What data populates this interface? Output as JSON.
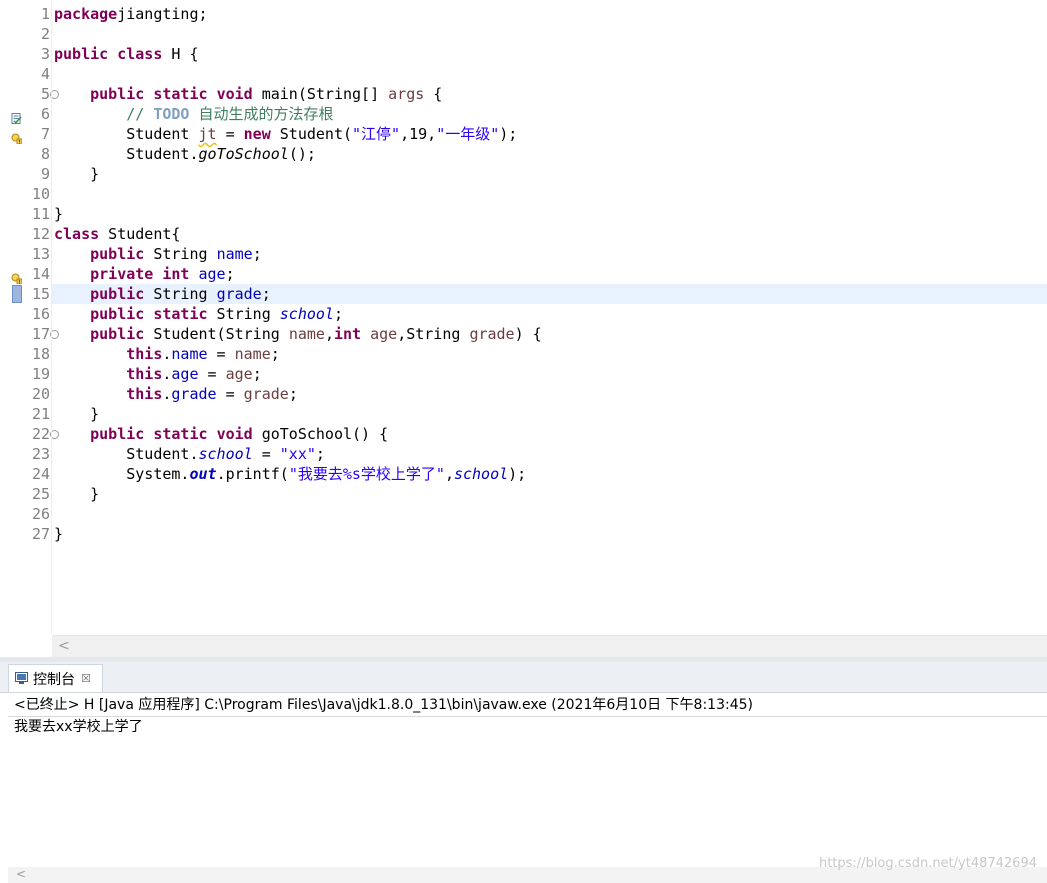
{
  "editor": {
    "lines": [
      {
        "n": "1",
        "fold": false,
        "t": [
          [
            "kw",
            "package"
          ],
          [
            "",
            "jiangting;"
          ]
        ]
      },
      {
        "n": "2",
        "fold": false,
        "t": []
      },
      {
        "n": "3",
        "fold": false,
        "t": [
          [
            "kw",
            "public"
          ],
          [
            "",
            " "
          ],
          [
            "kw",
            "class"
          ],
          [
            "",
            " H {"
          ]
        ]
      },
      {
        "n": "4",
        "fold": false,
        "t": []
      },
      {
        "n": "5",
        "fold": true,
        "t": [
          [
            "",
            "    "
          ],
          [
            "kw",
            "public"
          ],
          [
            "",
            " "
          ],
          [
            "kw",
            "static"
          ],
          [
            "",
            " "
          ],
          [
            "kw",
            "void"
          ],
          [
            "",
            " main(String[] "
          ],
          [
            "var",
            "args"
          ],
          [
            "",
            " {"
          ]
        ]
      },
      {
        "n": "6",
        "fold": false,
        "t": [
          [
            "",
            "        "
          ],
          [
            "cmt",
            "// "
          ],
          [
            "todo",
            "TODO"
          ],
          [
            "cmt",
            " 自动生成的方法存根"
          ]
        ]
      },
      {
        "n": "7",
        "fold": false,
        "t": [
          [
            "",
            "        Student "
          ],
          [
            "var warn",
            "jt"
          ],
          [
            "",
            " = "
          ],
          [
            "kw",
            "new"
          ],
          [
            "",
            " Student("
          ],
          [
            "str",
            "\"江停\""
          ],
          [
            "",
            ",19,"
          ],
          [
            "str",
            "\"一年级\""
          ],
          [
            "",
            ");"
          ]
        ]
      },
      {
        "n": "8",
        "fold": false,
        "t": [
          [
            "",
            "        Student."
          ],
          [
            "smeth",
            "goToSchool"
          ],
          [
            "",
            "();"
          ]
        ]
      },
      {
        "n": "9",
        "fold": false,
        "t": [
          [
            "",
            "    }"
          ]
        ]
      },
      {
        "n": "10",
        "fold": false,
        "t": []
      },
      {
        "n": "11",
        "fold": false,
        "t": [
          [
            "",
            "}"
          ]
        ]
      },
      {
        "n": "12",
        "fold": false,
        "t": [
          [
            "kw",
            "class"
          ],
          [
            "",
            " Student{"
          ]
        ]
      },
      {
        "n": "13",
        "fold": false,
        "t": [
          [
            "",
            "    "
          ],
          [
            "kw",
            "public"
          ],
          [
            "",
            " String "
          ],
          [
            "fld",
            "name"
          ],
          [
            "",
            ";"
          ]
        ]
      },
      {
        "n": "14",
        "fold": false,
        "t": [
          [
            "",
            "    "
          ],
          [
            "kw",
            "private"
          ],
          [
            "",
            " "
          ],
          [
            "kw",
            "int"
          ],
          [
            "",
            " "
          ],
          [
            "fld",
            "age"
          ],
          [
            "",
            ";"
          ]
        ]
      },
      {
        "n": "15",
        "fold": false,
        "t": [
          [
            "",
            "    "
          ],
          [
            "kw",
            "public"
          ],
          [
            "",
            " String "
          ],
          [
            "fld",
            "grade"
          ],
          [
            "",
            ";"
          ]
        ]
      },
      {
        "n": "16",
        "fold": false,
        "t": [
          [
            "",
            "    "
          ],
          [
            "kw",
            "public"
          ],
          [
            "",
            " "
          ],
          [
            "kw",
            "static"
          ],
          [
            "",
            " String "
          ],
          [
            "sfld",
            "school"
          ],
          [
            "",
            ";"
          ]
        ]
      },
      {
        "n": "17",
        "fold": true,
        "t": [
          [
            "",
            "    "
          ],
          [
            "kw",
            "public"
          ],
          [
            "",
            " Student(String "
          ],
          [
            "var",
            "name"
          ],
          [
            "",
            ","
          ],
          [
            "kw",
            "int"
          ],
          [
            "",
            " "
          ],
          [
            "var",
            "age"
          ],
          [
            "",
            ",String "
          ],
          [
            "var",
            "grade"
          ],
          [
            "",
            ") {"
          ]
        ]
      },
      {
        "n": "18",
        "fold": false,
        "t": [
          [
            "",
            "        "
          ],
          [
            "kw",
            "this"
          ],
          [
            "",
            "."
          ],
          [
            "fld",
            "name"
          ],
          [
            "",
            " = "
          ],
          [
            "var",
            "name"
          ],
          [
            "",
            ";"
          ]
        ]
      },
      {
        "n": "19",
        "fold": false,
        "t": [
          [
            "",
            "        "
          ],
          [
            "kw",
            "this"
          ],
          [
            "",
            "."
          ],
          [
            "fld",
            "age"
          ],
          [
            "",
            " = "
          ],
          [
            "var",
            "age"
          ],
          [
            "",
            ";"
          ]
        ]
      },
      {
        "n": "20",
        "fold": false,
        "t": [
          [
            "",
            "        "
          ],
          [
            "kw",
            "this"
          ],
          [
            "",
            "."
          ],
          [
            "fld",
            "grade"
          ],
          [
            "",
            " = "
          ],
          [
            "var",
            "grade"
          ],
          [
            "",
            ";"
          ]
        ]
      },
      {
        "n": "21",
        "fold": false,
        "t": [
          [
            "",
            "    }"
          ]
        ]
      },
      {
        "n": "22",
        "fold": true,
        "t": [
          [
            "",
            "    "
          ],
          [
            "kw",
            "public"
          ],
          [
            "",
            " "
          ],
          [
            "kw",
            "static"
          ],
          [
            "",
            " "
          ],
          [
            "kw",
            "void"
          ],
          [
            "",
            " goToSchool() {"
          ]
        ]
      },
      {
        "n": "23",
        "fold": false,
        "t": [
          [
            "",
            "        Student."
          ],
          [
            "sfld",
            "school"
          ],
          [
            "",
            " = "
          ],
          [
            "str",
            "\"xx\""
          ],
          [
            "",
            ";"
          ]
        ]
      },
      {
        "n": "24",
        "fold": false,
        "t": [
          [
            "",
            "        System."
          ],
          [
            "sfldb",
            "out"
          ],
          [
            "",
            ".printf("
          ],
          [
            "str",
            "\"我要去%s学校上学了\""
          ],
          [
            "",
            ","
          ],
          [
            "sfld",
            "school"
          ],
          [
            "",
            ");"
          ]
        ]
      },
      {
        "n": "25",
        "fold": false,
        "t": [
          [
            "",
            "    }"
          ]
        ]
      },
      {
        "n": "26",
        "fold": false,
        "t": []
      },
      {
        "n": "27",
        "fold": false,
        "t": [
          [
            "",
            "}"
          ]
        ]
      }
    ],
    "current_line": 15,
    "gutter_markers": [
      {
        "line": 6,
        "icon": "task-icon"
      },
      {
        "line": 7,
        "icon": "warning-icon"
      },
      {
        "line": 14,
        "icon": "warning-icon"
      },
      {
        "line": 15,
        "icon": "cursor-marker-icon"
      }
    ],
    "fold_symbol": "⊖",
    "scroll_left_symbol": "<"
  },
  "console": {
    "tab_label": "控制台",
    "tab_icon": "console-icon",
    "close_symbol": "☒",
    "status": "<已终止> H [Java 应用程序] C:\\Program Files\\Java\\jdk1.8.0_131\\bin\\javaw.exe  (2021年6月10日 下午8:13:45)",
    "output": "我要去xx学校上学了",
    "scroll_left_symbol": "<"
  },
  "watermark": "https://blog.csdn.net/yt48742694",
  "colors": {
    "keyword": "#7f0055",
    "string": "#2a00ff",
    "field": "#0000c0",
    "comment": "#3f7f5f",
    "todo": "#7f9fbf",
    "local_variable": "#6a3e3e",
    "current_line": "#e8f2fe",
    "line_number": "#808080"
  }
}
